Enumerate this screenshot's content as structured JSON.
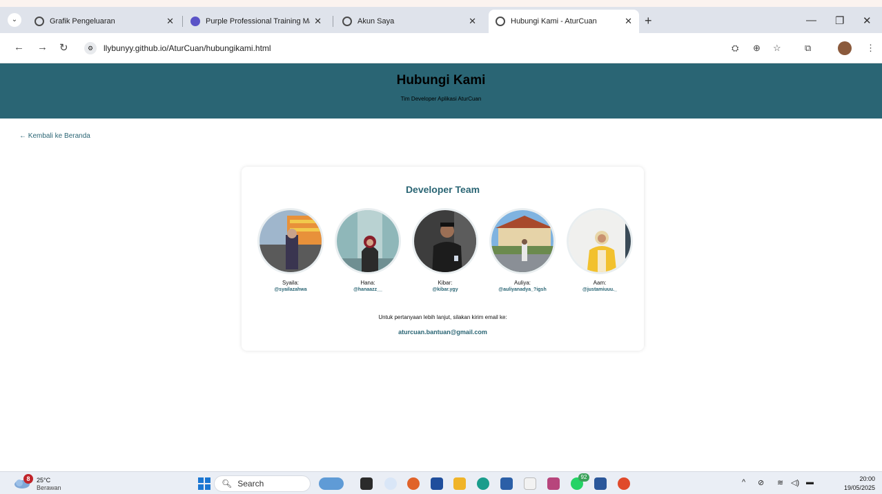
{
  "browser": {
    "tabs": [
      {
        "title": "Grafik Pengeluaran",
        "active": false
      },
      {
        "title": "Purple Professional Training Ma",
        "active": false
      },
      {
        "title": "Akun Saya",
        "active": false
      },
      {
        "title": "Hubungi Kami - AturCuan",
        "active": true
      }
    ],
    "url": "llybunyy.github.io/AturCuan/hubungikami.html",
    "accent": "#2a6574"
  },
  "page": {
    "title": "Hubungi Kami",
    "subtitle": "Tim Developer Aplikasi AturCuan",
    "back_link": "← Kembali ke Beranda",
    "card_title": "Developer Team",
    "members": [
      {
        "name": "Syaila:",
        "handle": "@syailazahwa"
      },
      {
        "name": "Hana:",
        "handle": "@hanaazz__"
      },
      {
        "name": "Kibar:",
        "handle": "@kibar.ygy"
      },
      {
        "name": "Auliya:",
        "handle": "@auliyanadya_?igsh"
      },
      {
        "name": "Aam:",
        "handle": "@justamiuuu._"
      }
    ],
    "contact_text": "Untuk pertanyaan lebih lanjut, silakan kirim email ke:",
    "contact_email": "aturcuan.bantuan@gmail.com"
  },
  "taskbar": {
    "weather_badge": "8",
    "temperature": "25°C",
    "weather_desc": "Berawan",
    "search_label": "Search",
    "chat_badge": "92",
    "time": "20:00",
    "date": "19/05/2025"
  }
}
